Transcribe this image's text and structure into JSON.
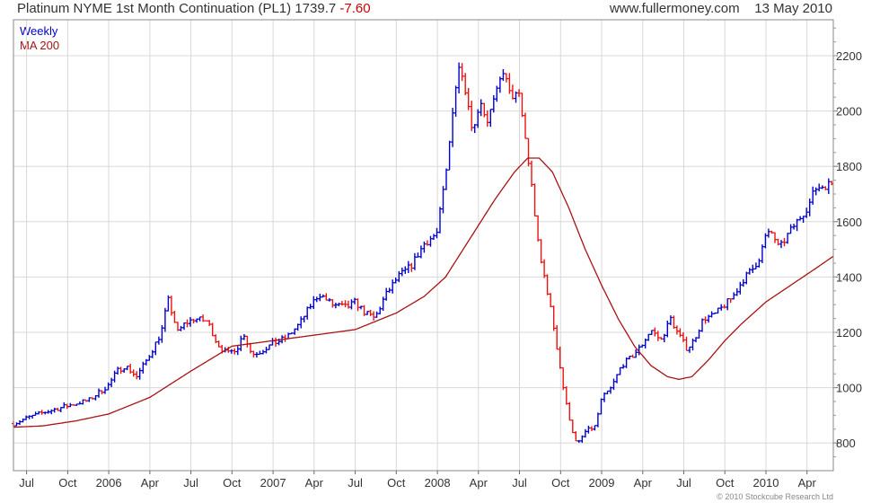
{
  "header": {
    "title": "Platinum NYME 1st Month Continuation (PL1)",
    "last": "1739.7",
    "change": "-7.60",
    "site": "www.fullermoney.com",
    "date": "13 May 2010"
  },
  "footer": {
    "copyright": "© 2010 Stockcube Research Ltd"
  },
  "colors": {
    "up": "#0000cc",
    "down": "#ee1111",
    "ma": "#aa1111",
    "grid": "#d8d8d8"
  },
  "chart_data": {
    "type": "ohlc",
    "interval": "weekly",
    "y_range": [
      700,
      2330
    ],
    "y_ticks": [
      800,
      1000,
      1200,
      1400,
      1600,
      1800,
      2000,
      2200
    ],
    "x_range": [
      2005.42,
      2010.41
    ],
    "x_ticks": [
      {
        "label": "Jul",
        "t": 2005.5
      },
      {
        "label": "Oct",
        "t": 2005.75
      },
      {
        "label": "2006",
        "t": 2006.0
      },
      {
        "label": "Apr",
        "t": 2006.25
      },
      {
        "label": "Jul",
        "t": 2006.5
      },
      {
        "label": "Oct",
        "t": 2006.75
      },
      {
        "label": "2007",
        "t": 2007.0
      },
      {
        "label": "Apr",
        "t": 2007.25
      },
      {
        "label": "Jul",
        "t": 2007.5
      },
      {
        "label": "Oct",
        "t": 2007.75
      },
      {
        "label": "2008",
        "t": 2008.0
      },
      {
        "label": "Apr",
        "t": 2008.25
      },
      {
        "label": "Jul",
        "t": 2008.5
      },
      {
        "label": "Oct",
        "t": 2008.75
      },
      {
        "label": "2009",
        "t": 2009.0
      },
      {
        "label": "Apr",
        "t": 2009.25
      },
      {
        "label": "Jul",
        "t": 2009.5
      },
      {
        "label": "Oct",
        "t": 2009.75
      },
      {
        "label": "2010",
        "t": 2010.0
      },
      {
        "label": "Apr",
        "t": 2010.25
      }
    ],
    "series": [
      {
        "name": "Weekly",
        "style": "ohlc-bars",
        "path": [
          [
            2005.42,
            870
          ],
          [
            2005.5,
            890
          ],
          [
            2005.6,
            910
          ],
          [
            2005.75,
            935
          ],
          [
            2005.88,
            955
          ],
          [
            2006.0,
            1010
          ],
          [
            2006.05,
            1060
          ],
          [
            2006.1,
            1080
          ],
          [
            2006.17,
            1040
          ],
          [
            2006.25,
            1120
          ],
          [
            2006.32,
            1200
          ],
          [
            2006.36,
            1320
          ],
          [
            2006.42,
            1200
          ],
          [
            2006.46,
            1230
          ],
          [
            2006.52,
            1250
          ],
          [
            2006.6,
            1240
          ],
          [
            2006.66,
            1160
          ],
          [
            2006.72,
            1120
          ],
          [
            2006.79,
            1150
          ],
          [
            2006.82,
            1200
          ],
          [
            2006.87,
            1120
          ],
          [
            2006.92,
            1130
          ],
          [
            2007.0,
            1160
          ],
          [
            2007.08,
            1180
          ],
          [
            2007.16,
            1230
          ],
          [
            2007.22,
            1290
          ],
          [
            2007.28,
            1340
          ],
          [
            2007.36,
            1300
          ],
          [
            2007.45,
            1290
          ],
          [
            2007.5,
            1310
          ],
          [
            2007.56,
            1270
          ],
          [
            2007.62,
            1250
          ],
          [
            2007.68,
            1330
          ],
          [
            2007.76,
            1400
          ],
          [
            2007.84,
            1440
          ],
          [
            2007.92,
            1520
          ],
          [
            2008.0,
            1560
          ],
          [
            2008.02,
            1650
          ],
          [
            2008.06,
            1800
          ],
          [
            2008.1,
            2050
          ],
          [
            2008.14,
            2180
          ],
          [
            2008.18,
            2050
          ],
          [
            2008.22,
            1920
          ],
          [
            2008.26,
            2050
          ],
          [
            2008.3,
            1960
          ],
          [
            2008.36,
            2060
          ],
          [
            2008.4,
            2150
          ],
          [
            2008.44,
            2060
          ],
          [
            2008.5,
            2050
          ],
          [
            2008.54,
            1880
          ],
          [
            2008.58,
            1700
          ],
          [
            2008.62,
            1480
          ],
          [
            2008.66,
            1380
          ],
          [
            2008.7,
            1250
          ],
          [
            2008.74,
            1100
          ],
          [
            2008.78,
            950
          ],
          [
            2008.82,
            850
          ],
          [
            2008.85,
            790
          ],
          [
            2008.9,
            840
          ],
          [
            2008.96,
            860
          ],
          [
            2009.0,
            960
          ],
          [
            2009.06,
            1000
          ],
          [
            2009.12,
            1080
          ],
          [
            2009.18,
            1110
          ],
          [
            2009.24,
            1150
          ],
          [
            2009.3,
            1210
          ],
          [
            2009.36,
            1170
          ],
          [
            2009.42,
            1250
          ],
          [
            2009.46,
            1200
          ],
          [
            2009.52,
            1140
          ],
          [
            2009.56,
            1170
          ],
          [
            2009.62,
            1250
          ],
          [
            2009.68,
            1260
          ],
          [
            2009.75,
            1300
          ],
          [
            2009.8,
            1330
          ],
          [
            2009.86,
            1390
          ],
          [
            2009.92,
            1430
          ],
          [
            2009.96,
            1470
          ],
          [
            2010.0,
            1550
          ],
          [
            2010.04,
            1560
          ],
          [
            2010.08,
            1500
          ],
          [
            2010.14,
            1560
          ],
          [
            2010.2,
            1610
          ],
          [
            2010.26,
            1660
          ],
          [
            2010.3,
            1720
          ],
          [
            2010.35,
            1730
          ],
          [
            2010.41,
            1740
          ]
        ]
      },
      {
        "name": "MA 200",
        "style": "line",
        "path": [
          [
            2005.42,
            857
          ],
          [
            2005.6,
            862
          ],
          [
            2005.8,
            880
          ],
          [
            2006.0,
            905
          ],
          [
            2006.25,
            965
          ],
          [
            2006.5,
            1060
          ],
          [
            2006.75,
            1150
          ],
          [
            2007.0,
            1170
          ],
          [
            2007.25,
            1190
          ],
          [
            2007.5,
            1210
          ],
          [
            2007.75,
            1270
          ],
          [
            2007.92,
            1330
          ],
          [
            2008.05,
            1400
          ],
          [
            2008.2,
            1540
          ],
          [
            2008.35,
            1680
          ],
          [
            2008.47,
            1780
          ],
          [
            2008.55,
            1830
          ],
          [
            2008.62,
            1830
          ],
          [
            2008.7,
            1780
          ],
          [
            2008.8,
            1650
          ],
          [
            2008.9,
            1500
          ],
          [
            2009.0,
            1370
          ],
          [
            2009.1,
            1250
          ],
          [
            2009.2,
            1150
          ],
          [
            2009.3,
            1080
          ],
          [
            2009.4,
            1040
          ],
          [
            2009.47,
            1030
          ],
          [
            2009.55,
            1040
          ],
          [
            2009.65,
            1100
          ],
          [
            2009.75,
            1170
          ],
          [
            2009.85,
            1230
          ],
          [
            2010.0,
            1310
          ],
          [
            2010.15,
            1370
          ],
          [
            2010.3,
            1430
          ],
          [
            2010.41,
            1475
          ]
        ]
      }
    ]
  }
}
